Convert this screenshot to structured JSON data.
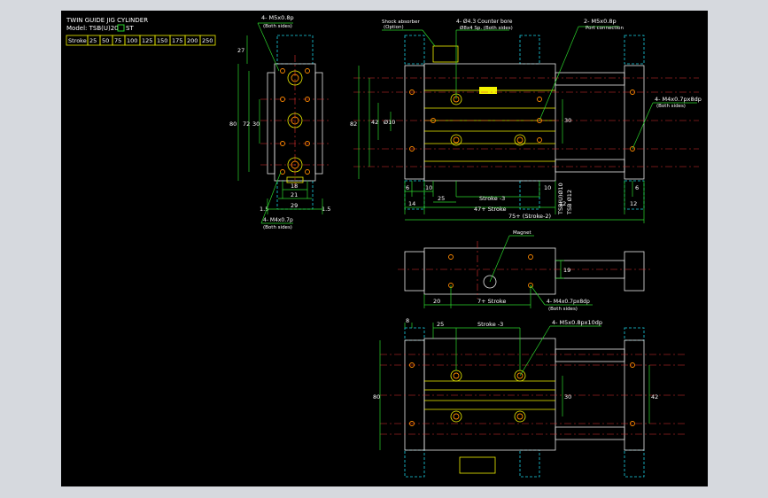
{
  "title": "TWIN GUIDE JIG CYLINDER",
  "model": {
    "prefix": "Model: TSB(U)20",
    "suffix": "ST"
  },
  "stroke_table": {
    "header": "Stroke",
    "values": [
      "25",
      "50",
      "75",
      "100",
      "125",
      "150",
      "175",
      "200",
      "250"
    ]
  },
  "callouts": {
    "m5_top": "4- M5x0.8p",
    "both_sides_1": "(Both sides)",
    "shock_absorber": "Shock absorber",
    "option": "(Option)",
    "counter_bore": "4- Ø4.3 Counter bore",
    "counter_bore_2": "Ø8x4 Sp. (Both sides)",
    "port": "2- M5x0.8p",
    "port_conn": "Port connection",
    "m4_right": "4- M4x0.7px8dp",
    "both_sides_2": "(Both sides)",
    "m4_left": "4- M4x0.7p",
    "both_sides_3": "(Both sides)",
    "magnet": "Magnet",
    "m4_mid": "4- M4x0.7px8dp",
    "both_sides_4": "(Both sides)",
    "m5_bottom": "4- M5x0.8px10dp"
  },
  "dims": {
    "d27": "27",
    "d80": "80",
    "d72": "72",
    "d30": "30",
    "d18": "18",
    "d21": "21",
    "d29": "29",
    "d15a": "1.5",
    "d15b": "1.5",
    "d82": "82",
    "d42": "42",
    "d10": "Ø10",
    "d30b": "30",
    "d6": "6",
    "d10b": "10",
    "d25": "25",
    "stroke3": "Stroke -3",
    "d10c": "10",
    "d6b": "6",
    "tsbu": "TSB(U)Ø10",
    "tsb": "TSB Ø12",
    "d14": "14",
    "d47": "47+ Stroke",
    "d12": "12",
    "d12b": "12",
    "d75": "75+ (Stroke-2)",
    "d19": "19",
    "d20": "20",
    "d7": "7+ Stroke",
    "d8": "8",
    "d25b": "25",
    "stroke3b": "Stroke -3",
    "d80b": "80",
    "d30c": "30",
    "d42b": "42"
  }
}
